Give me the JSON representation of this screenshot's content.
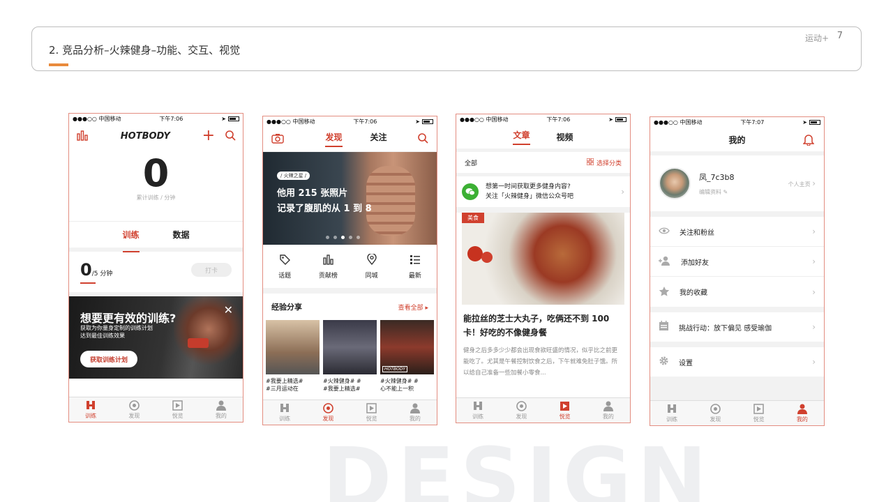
{
  "slide": {
    "title": "2. 竞品分析–火辣健身–功能、交互、视觉",
    "brand": "运动+",
    "page": "7",
    "watermark": "DESIGN"
  },
  "status": {
    "carrier": "●●●○○ 中国移动",
    "time1": "下午7:06",
    "time4": "下午7:07"
  },
  "tabs": {
    "train": "训练",
    "discover": "发现",
    "article": "悦览",
    "mine": "我的"
  },
  "p1": {
    "logo": "HOTBODY",
    "big_number": "0",
    "big_caption": "累计训练 / 分钟",
    "tab_train": "训练",
    "tab_data": "数据",
    "today_value": "0",
    "today_unit": "/5 分钟",
    "checkin": "打卡",
    "banner_title": "想要更有效的训练?",
    "banner_sub1": "获取为你量身定制的训练计划",
    "banner_sub2": "达到最佳训练效果",
    "banner_btn": "获取训练计划"
  },
  "p2": {
    "tab_discover": "发现",
    "tab_follow": "关注",
    "hero_tag": "/ 火辣之星 /",
    "hero_line1": "他用 215 张照片",
    "hero_line2": "记录了腹肌的从 1 到 8",
    "cats": [
      "话题",
      "贡献榜",
      "同城",
      "最新"
    ],
    "section_title": "经验分享",
    "see_all": "查看全部",
    "thumbs": [
      {
        "l1": "#我要上精选#",
        "l2": "#三月运动在"
      },
      {
        "l1": "#火辣健身# #",
        "l2": "#我要上精选#"
      },
      {
        "l1": "#火辣健身# #",
        "l2": "心不能上一积"
      }
    ],
    "thumb_logo": "HOTBODY"
  },
  "p3": {
    "tab_article": "文章",
    "tab_video": "视频",
    "all": "全部",
    "select_cat": "选择分类",
    "wx_line1": "想第一时间获取更多健身内容?",
    "wx_line2": "关注「火辣健身」微信公众号吧",
    "food_tag": "美食",
    "article_title": "能拉丝的芝士大丸子，吃俩还不到 100 卡！好吃的不像健身餐",
    "article_body": "健身之后多多少少都会出现食欲旺盛的情况，似乎比之前更能吃了。尤其是午餐控制饮食之后，下午就难免肚子饿。所以给自己准备一些加餐小零食..."
  },
  "p4": {
    "title": "我的",
    "username": "凤_7c3b8",
    "edit_profile": "编辑资料",
    "homepage": "个人主页",
    "menu": [
      "关注和粉丝",
      "添加好友",
      "我的收藏"
    ],
    "challenge": "挑战行动：放下偏见 感受瑜伽",
    "settings": "设置"
  },
  "colors": {
    "accent": "#d0402e",
    "header_bar": "#e98a3c",
    "frame": "#e38d80"
  }
}
